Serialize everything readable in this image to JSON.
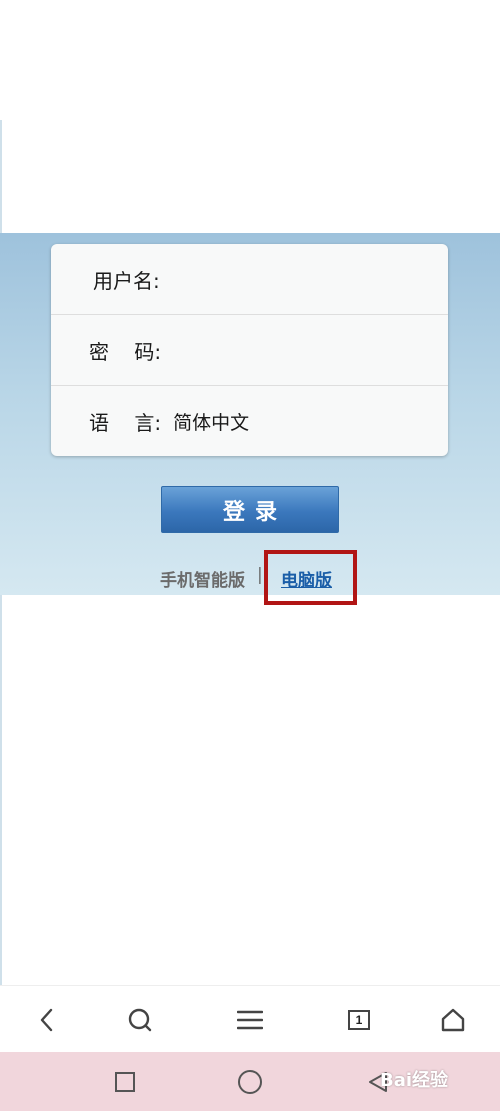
{
  "form": {
    "username_label": "用户名:",
    "password_label": "密    码:",
    "language_label": "语    言:",
    "language_value": "简体中文"
  },
  "login_button_label": "登录",
  "version_links": {
    "mobile": "手机智能版",
    "separator": "|",
    "pc": "电脑版"
  },
  "browser_toolbar": {
    "tab_count": "1",
    "icons": [
      "back-icon",
      "search-icon",
      "menu-icon",
      "tabs-icon",
      "home-icon"
    ]
  },
  "system_nav": {
    "icons": [
      "recent-apps-icon",
      "home-circle-icon",
      "back-triangle-icon"
    ]
  },
  "watermark_text": "Bai经验",
  "colors": {
    "band_top": "#9ec2dc",
    "button_blue": "#3b78bd",
    "link_blue": "#1a5ea8",
    "highlight_red": "#b11515",
    "system_nav_bg": "#f1d6dc"
  }
}
